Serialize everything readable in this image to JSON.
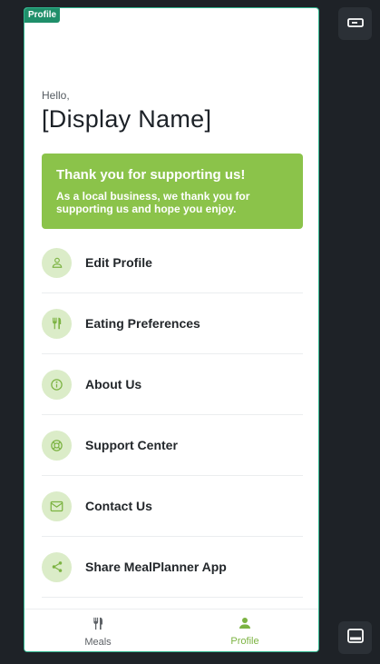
{
  "frame": {
    "tag": "Profile"
  },
  "header": {
    "greeting": "Hello,",
    "display_name": "[Display Name]"
  },
  "banner": {
    "title": "Thank you for supporting us!",
    "text": "As a local business, we thank you for supporting us and hope you enjoy."
  },
  "menu": {
    "items": [
      {
        "label": "Edit Profile",
        "icon": "person-icon"
      },
      {
        "label": "Eating Preferences",
        "icon": "fork-knife-icon"
      },
      {
        "label": "About Us",
        "icon": "info-icon"
      },
      {
        "label": "Support Center",
        "icon": "lifebuoy-icon"
      },
      {
        "label": "Contact Us",
        "icon": "mail-icon"
      },
      {
        "label": "Share MealPlanner App",
        "icon": "share-icon"
      }
    ]
  },
  "bottom_nav": {
    "tabs": [
      {
        "label": "Meals",
        "icon": "fork-knife-icon",
        "active": false
      },
      {
        "label": "Profile",
        "icon": "person-icon",
        "active": true
      }
    ]
  },
  "colors": {
    "accent": "#8bc34a",
    "active_tab": "#7cb342",
    "icon_bg": "#dbecc8",
    "icon_fg": "#7cb342",
    "frame_border": "#2fb58e",
    "background": "#1e2227"
  },
  "side_buttons": [
    {
      "icon": "rectangle-toggle-icon"
    },
    {
      "icon": "panel-bottom-icon"
    }
  ]
}
